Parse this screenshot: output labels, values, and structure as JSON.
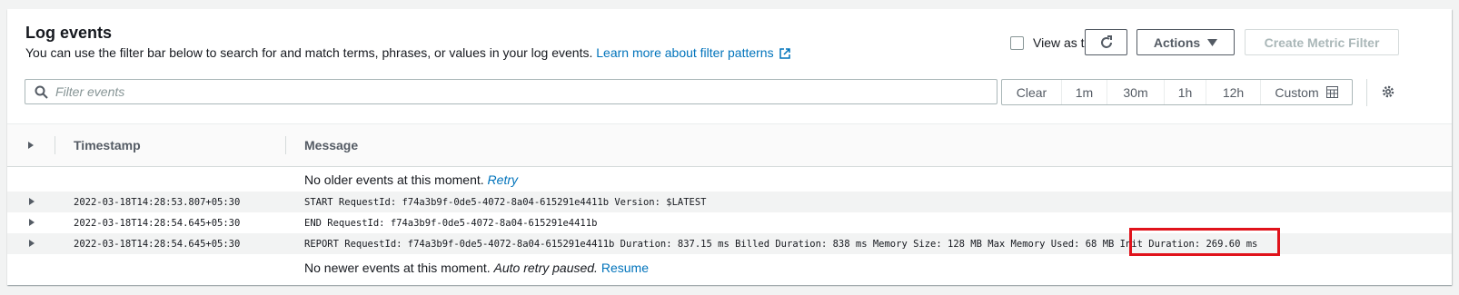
{
  "header": {
    "title": "Log events",
    "description": "You can use the filter bar below to search for and match terms, phrases, or values in your log events.",
    "learn_more": "Learn more about filter patterns"
  },
  "toolbar": {
    "view_as_text": "View as text",
    "actions_label": "Actions",
    "create_metric_filter": "Create Metric Filter"
  },
  "filter": {
    "placeholder": "Filter events",
    "time_buttons": [
      "Clear",
      "1m",
      "30m",
      "1h",
      "12h",
      "Custom"
    ]
  },
  "table": {
    "headers": [
      "Timestamp",
      "Message"
    ],
    "older_msg": "No older events at this moment.",
    "retry": "Retry",
    "rows": [
      {
        "timestamp": "2022-03-18T14:28:53.807+05:30",
        "message": "START RequestId: f74a3b9f-0de5-4072-8a04-615291e4411b Version: $LATEST"
      },
      {
        "timestamp": "2022-03-18T14:28:54.645+05:30",
        "message": "END RequestId: f74a3b9f-0de5-4072-8a04-615291e4411b"
      },
      {
        "timestamp": "2022-03-18T14:28:54.645+05:30",
        "message": "REPORT RequestId: f74a3b9f-0de5-4072-8a04-615291e4411b Duration: 837.15 ms Billed Duration: 838 ms Memory Size: 128 MB Max Memory Used: 68 MB Init Duration: 269.60 ms"
      }
    ],
    "newer_msg": "No newer events at this moment.",
    "auto_retry": "Auto retry paused.",
    "resume": "Resume"
  },
  "colors": {
    "link": "#0073bb",
    "highlight": "#e0131b"
  }
}
